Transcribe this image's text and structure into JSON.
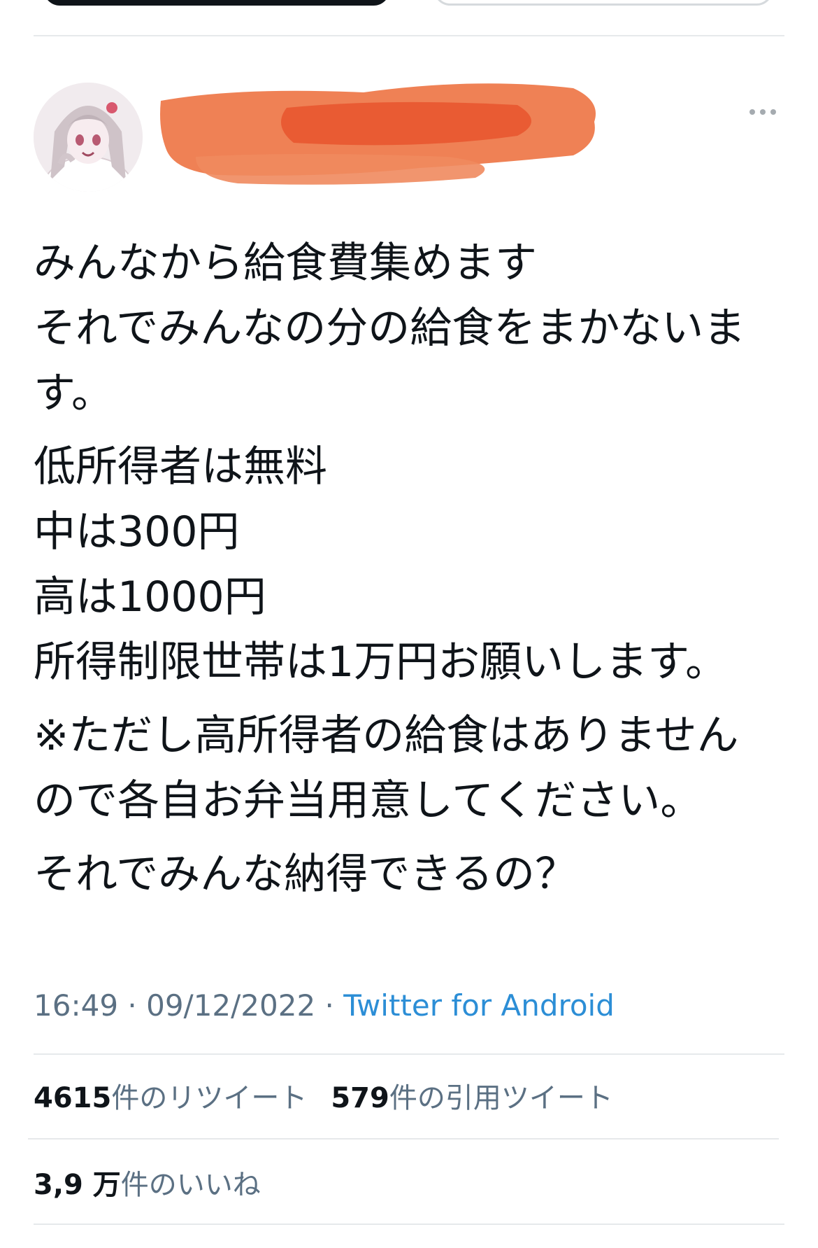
{
  "tweet": {
    "lines_block1": [
      "みんなから給食費集めます",
      "それでみんなの分の給食をまかないま",
      "す。"
    ],
    "lines_block2": [
      "低所得者は無料",
      "中は300円",
      "高は1000円",
      "所得制限世帯は1万円お願いします。"
    ],
    "lines_block3": [
      "※ただし高所得者の給食はありません",
      "ので各自お弁当用意してください。"
    ],
    "lines_block4": [
      "それでみんな納得できるの？"
    ]
  },
  "meta": {
    "time": "16:49",
    "sep1": " · ",
    "date": "09/12/2022",
    "sep2": " · ",
    "source": "Twitter for Android"
  },
  "stats": {
    "retweets_count": "4615",
    "retweets_label": "件のリツイート",
    "quotes_count": "579",
    "quotes_label": "件の引用ツイート",
    "likes_count": "3,9 万",
    "likes_label": "件のいいね"
  },
  "icons": {
    "more": "more-horizontal-icon"
  },
  "colors": {
    "text": "#0f1419",
    "secondary": "#5b7083",
    "link": "#2c8ed6",
    "redaction": "#ee6a3a"
  }
}
